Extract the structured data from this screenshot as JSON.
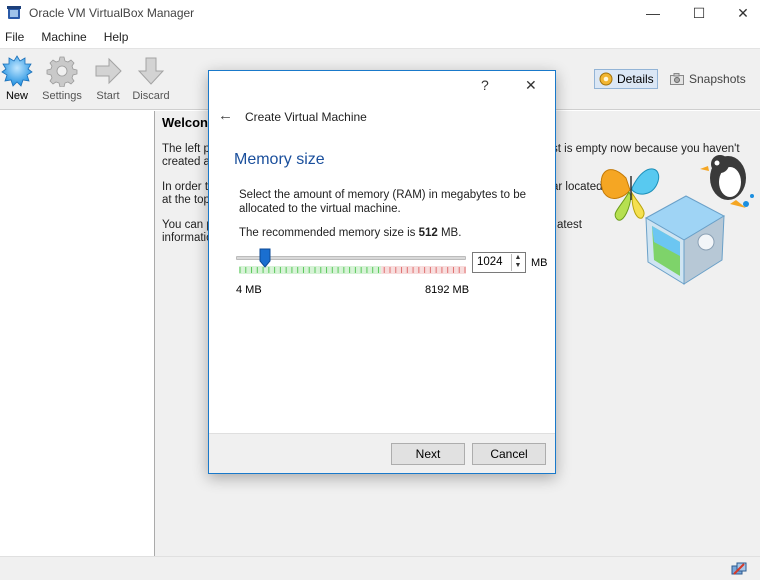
{
  "window": {
    "title": "Oracle VM VirtualBox Manager",
    "minimize_glyph": "—",
    "maximize_glyph": "☐",
    "close_glyph": "✕"
  },
  "menu": [
    "File",
    "Machine",
    "Help"
  ],
  "toolbar": {
    "new_label": "New",
    "settings_label": "Settings",
    "start_label": "Start",
    "discard_label": "Discard",
    "details_label": "Details",
    "snapshots_label": "Snapshots"
  },
  "welcome": {
    "title": "Welcon",
    "p1_left_line1": "The left p",
    "p1_left_line2": "created a",
    "p1_right_line1": "st is empty now because you haven't",
    "p2_left_line1": "In order t",
    "p2_left_line2": "at the top",
    "p2_right_line1": "ar located",
    "p3_left_line1": "You can p",
    "p3_left_line2": "informatio",
    "p3_right_line1": "atest"
  },
  "dialog": {
    "help_glyph": "?",
    "close_glyph": "✕",
    "back_glyph": "←",
    "header": "Create Virtual Machine",
    "page_title": "Memory size",
    "description": "Select the amount of memory (RAM) in megabytes to be allocated to the virtual machine.",
    "recommend_prefix": "The recommended memory size is ",
    "recommend_value": "512",
    "recommend_suffix": " MB.",
    "memory": {
      "value": "1024",
      "unit": "MB",
      "min_label": "4 MB",
      "max_label": "8192 MB",
      "slider_fraction": 0.125
    },
    "next_label": "Next",
    "cancel_label": "Cancel"
  },
  "colors": {
    "accent": "#1979ca",
    "title_blue": "#1a4f9c",
    "tick_green": "#5ac85a",
    "tick_red": "#e07070"
  }
}
